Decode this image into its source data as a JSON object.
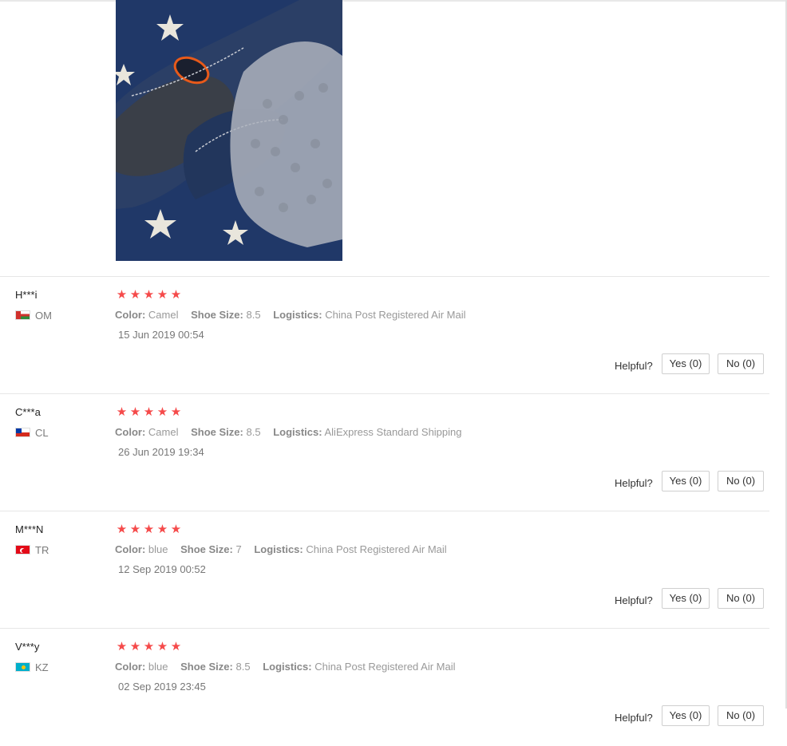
{
  "labels": {
    "color": "Color:",
    "shoe_size": "Shoe Size:",
    "logistics": "Logistics:",
    "helpful": "Helpful?"
  },
  "reviews": [
    {
      "user": "H***i",
      "country": "OM",
      "rating": 5,
      "stars": "★★★★★",
      "color": "Camel",
      "shoe_size": "8.5",
      "logistics": "China Post Registered Air Mail",
      "date": "15 Jun 2019 00:54",
      "yes": "Yes (0)",
      "no": "No (0)"
    },
    {
      "user": "C***a",
      "country": "CL",
      "rating": 5,
      "stars": "★★★★★",
      "color": "Camel",
      "shoe_size": "8.5",
      "logistics": "AliExpress Standard Shipping",
      "date": "26 Jun 2019 19:34",
      "yes": "Yes (0)",
      "no": "No (0)"
    },
    {
      "user": "M***N",
      "country": "TR",
      "rating": 5,
      "stars": "★★★★★",
      "color": "blue",
      "shoe_size": "7",
      "logistics": "China Post Registered Air Mail",
      "date": "12 Sep 2019 00:52",
      "yes": "Yes (0)",
      "no": "No (0)"
    },
    {
      "user": "V***y",
      "country": "KZ",
      "rating": 5,
      "stars": "★★★★★",
      "color": "blue",
      "shoe_size": "8.5",
      "logistics": "China Post Registered Air Mail",
      "date": "02 Sep 2019 23:45",
      "yes": "Yes (0)",
      "no": "No (0)"
    }
  ],
  "colors": {
    "star": "#f54a4a",
    "divider": "#e6e6e6"
  }
}
